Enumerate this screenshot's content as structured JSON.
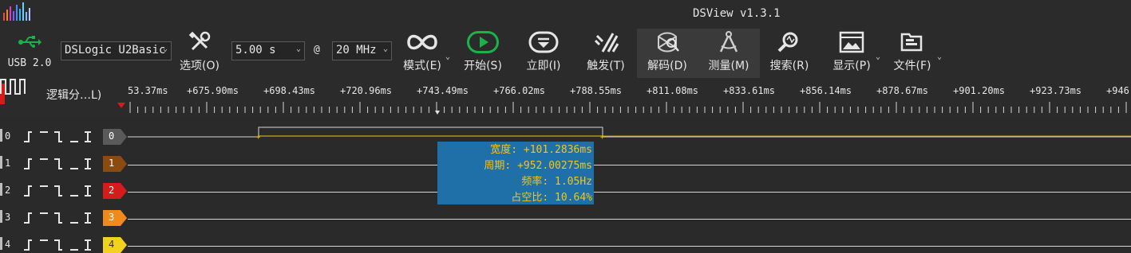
{
  "window": {
    "title": "DSView v1.3.1"
  },
  "toolbar": {
    "usb_label": "USB 2.0",
    "device": "DSLogic U2Basic",
    "options_label": "选项(O)",
    "sample_time": "5.00 s",
    "at": "@",
    "sample_rate": "20 MHz",
    "mode_label": "模式(E)",
    "start_label": "开始(S)",
    "instant_label": "立即(I)",
    "trigger_label": "触发(T)",
    "decode_label": "解码(D)",
    "measure_label": "测量(M)",
    "search_label": "搜索(R)",
    "display_label": "显示(P)",
    "file_label": "文件(F)",
    "accent_green": "#19b34a"
  },
  "ruler": {
    "group_label": "逻辑分…L)",
    "ticks": [
      "53.37ms",
      "+675.90ms",
      "+698.43ms",
      "+720.96ms",
      "+743.49ms",
      "+766.02ms",
      "+788.55ms",
      "+811.08ms",
      "+833.61ms",
      "+856.14ms",
      "+878.67ms",
      "+901.20ms",
      "+923.73ms",
      "+946"
    ]
  },
  "channels": [
    {
      "index": "0",
      "tag": "0",
      "color": "#5a5a5a",
      "text_color": "#ffffff"
    },
    {
      "index": "1",
      "tag": "1",
      "color": "#8a4a10",
      "text_color": "#ffffff"
    },
    {
      "index": "2",
      "tag": "2",
      "color": "#d41c1c",
      "text_color": "#ffffff"
    },
    {
      "index": "3",
      "tag": "3",
      "color": "#f08a1c",
      "text_color": "#ffffff"
    },
    {
      "index": "4",
      "tag": "4",
      "color": "#f2d21c",
      "text_color": "#333333"
    }
  ],
  "measurement": {
    "width": "宽度: +101.2836ms",
    "period": "周期: +952.00275ms",
    "frequency": "频率: 1.05Hz",
    "duty": "占空比: 10.64%"
  }
}
